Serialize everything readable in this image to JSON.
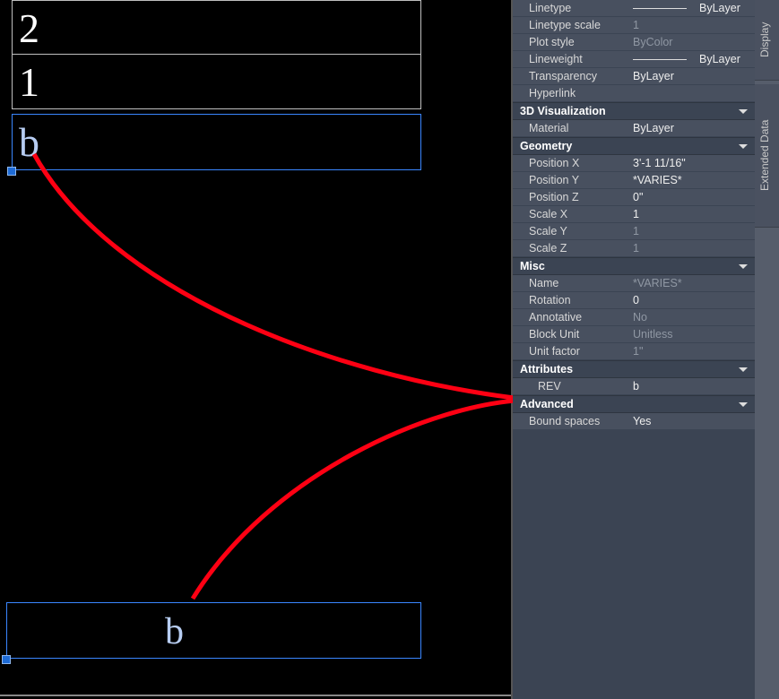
{
  "canvas": {
    "cells": {
      "c1": "2",
      "c2": "1",
      "c3": "b",
      "c_bottom": "b"
    }
  },
  "side_tabs": {
    "display": "Display",
    "extdata": "Extended Data"
  },
  "panel": {
    "general": {
      "linetype": {
        "label": "Linetype",
        "value": "ByLayer"
      },
      "ltscale": {
        "label": "Linetype scale",
        "value": "1"
      },
      "plotstyle": {
        "label": "Plot style",
        "value": "ByColor"
      },
      "lweight": {
        "label": "Lineweight",
        "value": "ByLayer"
      },
      "transp": {
        "label": "Transparency",
        "value": "ByLayer"
      },
      "hyper": {
        "label": "Hyperlink",
        "value": ""
      }
    },
    "vis3d": {
      "title": "3D Visualization",
      "material": {
        "label": "Material",
        "value": "ByLayer"
      }
    },
    "geom": {
      "title": "Geometry",
      "posx": {
        "label": "Position X",
        "value": "3'-1 11/16\""
      },
      "posy": {
        "label": "Position Y",
        "value": "*VARIES*"
      },
      "posz": {
        "label": "Position Z",
        "value": "0\""
      },
      "sx": {
        "label": "Scale X",
        "value": "1"
      },
      "sy": {
        "label": "Scale Y",
        "value": "1"
      },
      "sz": {
        "label": "Scale Z",
        "value": "1"
      }
    },
    "misc": {
      "title": "Misc",
      "name": {
        "label": "Name",
        "value": "*VARIES*"
      },
      "rot": {
        "label": "Rotation",
        "value": "0"
      },
      "anno": {
        "label": "Annotative",
        "value": "No"
      },
      "bunit": {
        "label": "Block Unit",
        "value": "Unitless"
      },
      "ufac": {
        "label": "Unit factor",
        "value": "1\""
      }
    },
    "attr": {
      "title": "Attributes",
      "rev": {
        "label": "REV",
        "value": "b"
      }
    },
    "adv": {
      "title": "Advanced",
      "bound": {
        "label": "Bound spaces",
        "value": "Yes"
      }
    }
  }
}
